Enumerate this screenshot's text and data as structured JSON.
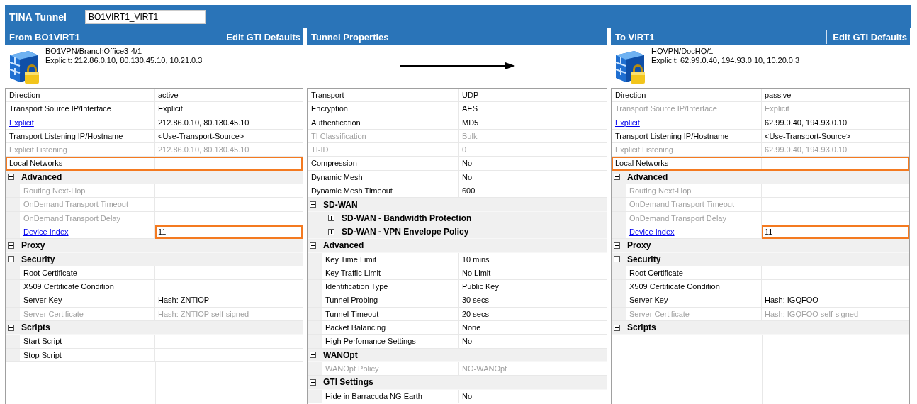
{
  "tunnel": {
    "label": "TINA Tunnel",
    "name": "BO1VIRT1_VIRT1"
  },
  "panels": [
    {
      "kind": "endpoint",
      "title": "From BO1VIRT1",
      "edit_button": "Edit GTI Defaults",
      "device": {
        "name": "BO1VPN/BranchOffice3-4/1",
        "address": "Explicit: 212.86.0.10, 80.130.45.10, 10.21.0.3"
      },
      "rows": [
        {
          "kind": "property",
          "label": "Direction",
          "value": "active",
          "disabled": false,
          "link": false
        },
        {
          "kind": "property",
          "label": "Transport Source IP/Interface",
          "value": "Explicit",
          "disabled": false,
          "link": false
        },
        {
          "kind": "property",
          "label": "Explicit",
          "value": "212.86.0.10, 80.130.45.10",
          "disabled": false,
          "link": true
        },
        {
          "kind": "property",
          "label": "Transport Listening IP/Hostname",
          "value": "<Use-Transport-Source>",
          "disabled": false,
          "link": false
        },
        {
          "kind": "property",
          "label": "Explicit Listening",
          "value": "212.86.0.10, 80.130.45.10",
          "disabled": true,
          "link": false
        },
        {
          "kind": "property",
          "label": "Local Networks",
          "disabled": false,
          "link": false,
          "highlighted": true
        },
        {
          "kind": "group",
          "label": "Advanced",
          "expanded": true,
          "children": [
            {
              "kind": "property",
              "label": "Routing Next-Hop",
              "disabled": true,
              "link": false
            },
            {
              "kind": "property",
              "label": "OnDemand Transport Timeout",
              "disabled": true,
              "link": false
            },
            {
              "kind": "property",
              "label": "OnDemand Transport Delay",
              "disabled": true,
              "link": false
            },
            {
              "kind": "property",
              "label": "Device Index",
              "value": "11",
              "disabled": false,
              "link": true,
              "value_highlighted": true
            }
          ]
        },
        {
          "kind": "group",
          "label": "Proxy",
          "expanded": false
        },
        {
          "kind": "group",
          "label": "Security",
          "expanded": true,
          "children": [
            {
              "kind": "property",
              "label": "Root Certificate",
              "disabled": false,
              "link": false
            },
            {
              "kind": "property",
              "label": "X509 Certificate Condition",
              "disabled": false,
              "link": false
            },
            {
              "kind": "property",
              "label": "Server Key",
              "value": "Hash: ZNTIOP",
              "disabled": false,
              "link": false
            },
            {
              "kind": "property",
              "label": "Server Certificate",
              "value": "Hash: ZNTIOP self-signed",
              "disabled": true,
              "link": false
            }
          ]
        },
        {
          "kind": "group",
          "label": "Scripts",
          "expanded": true,
          "children": [
            {
              "kind": "property",
              "label": "Start Script",
              "disabled": false,
              "link": false
            },
            {
              "kind": "property",
              "label": "Stop Script",
              "disabled": false,
              "link": false
            }
          ]
        }
      ]
    },
    {
      "kind": "tunnel",
      "title": "Tunnel Properties",
      "rows": [
        {
          "kind": "property",
          "label": "Transport",
          "value": "UDP",
          "disabled": false,
          "link": false
        },
        {
          "kind": "property",
          "label": "Encryption",
          "value": "AES",
          "disabled": false,
          "link": false
        },
        {
          "kind": "property",
          "label": "Authentication",
          "value": "MD5",
          "disabled": false,
          "link": false
        },
        {
          "kind": "property",
          "label": "TI Classification",
          "value": "Bulk",
          "disabled": true,
          "link": false
        },
        {
          "kind": "property",
          "label": "TI-ID",
          "value": "0",
          "disabled": true,
          "link": false
        },
        {
          "kind": "property",
          "label": "Compression",
          "value": "No",
          "disabled": false,
          "link": false
        },
        {
          "kind": "property",
          "label": "Dynamic Mesh",
          "value": "No",
          "disabled": false,
          "link": false
        },
        {
          "kind": "property",
          "label": "Dynamic Mesh Timeout",
          "value": "600",
          "disabled": false,
          "link": false
        },
        {
          "kind": "group",
          "label": "SD-WAN",
          "expanded": true,
          "children": [
            {
              "kind": "group",
              "label": "SD-WAN - Bandwidth Protection",
              "expanded": false
            },
            {
              "kind": "group",
              "label": "SD-WAN - VPN Envelope Policy",
              "expanded": false
            }
          ]
        },
        {
          "kind": "group",
          "label": "Advanced",
          "expanded": true,
          "children": [
            {
              "kind": "property",
              "label": "Key Time Limit",
              "value": "10 mins",
              "disabled": false,
              "link": false
            },
            {
              "kind": "property",
              "label": "Key Traffic Limit",
              "value": "No Limit",
              "disabled": false,
              "link": false
            },
            {
              "kind": "property",
              "label": "Identification Type",
              "value": "Public Key",
              "disabled": false,
              "link": false
            },
            {
              "kind": "property",
              "label": "Tunnel Probing",
              "value": "30 secs",
              "disabled": false,
              "link": false
            },
            {
              "kind": "property",
              "label": "Tunnel Timeout",
              "value": "20 secs",
              "disabled": false,
              "link": false
            },
            {
              "kind": "property",
              "label": "Packet Balancing",
              "value": "None",
              "disabled": false,
              "link": false
            },
            {
              "kind": "property",
              "label": "High Perfomance Settings",
              "value": "No",
              "disabled": false,
              "link": false
            }
          ]
        },
        {
          "kind": "group",
          "label": "WANOpt",
          "expanded": true,
          "children": [
            {
              "kind": "property",
              "label": "WANOpt Policy",
              "value": "NO-WANOpt",
              "disabled": true,
              "link": false
            }
          ]
        },
        {
          "kind": "group",
          "label": "GTI Settings",
          "expanded": true,
          "children": [
            {
              "kind": "property",
              "label": "Hide in Barracuda NG Earth",
              "value": "No",
              "disabled": false,
              "link": false
            }
          ]
        }
      ]
    },
    {
      "kind": "endpoint",
      "title": "To VIRT1",
      "edit_button": "Edit GTI Defaults",
      "device": {
        "name": "HQVPN/DocHQ/1",
        "address": "Explicit: 62.99.0.40, 194.93.0.10, 10.20.0.3"
      },
      "rows": [
        {
          "kind": "property",
          "label": "Direction",
          "value": "passive",
          "disabled": false,
          "link": false
        },
        {
          "kind": "property",
          "label": "Transport Source IP/Interface",
          "value": "Explicit",
          "disabled": true,
          "link": false
        },
        {
          "kind": "property",
          "label": "Explicit",
          "value": "62.99.0.40, 194.93.0.10",
          "disabled": false,
          "link": true
        },
        {
          "kind": "property",
          "label": "Transport Listening IP/Hostname",
          "value": "<Use-Transport-Source>",
          "disabled": false,
          "link": false
        },
        {
          "kind": "property",
          "label": "Explicit Listening",
          "value": "62.99.0.40, 194.93.0.10",
          "disabled": true,
          "link": false
        },
        {
          "kind": "property",
          "label": "Local Networks",
          "disabled": false,
          "link": false,
          "highlighted": true
        },
        {
          "kind": "group",
          "label": "Advanced",
          "expanded": true,
          "children": [
            {
              "kind": "property",
              "label": "Routing Next-Hop",
              "disabled": true,
              "link": false
            },
            {
              "kind": "property",
              "label": "OnDemand Transport Timeout",
              "disabled": true,
              "link": false
            },
            {
              "kind": "property",
              "label": "OnDemand Transport Delay",
              "disabled": true,
              "link": false
            },
            {
              "kind": "property",
              "label": "Device Index",
              "value": "11",
              "disabled": false,
              "link": true,
              "value_highlighted": true
            }
          ]
        },
        {
          "kind": "group",
          "label": "Proxy",
          "expanded": false
        },
        {
          "kind": "group",
          "label": "Security",
          "expanded": true,
          "children": [
            {
              "kind": "property",
              "label": "Root Certificate",
              "disabled": false,
              "link": false
            },
            {
              "kind": "property",
              "label": "X509 Certificate Condition",
              "disabled": false,
              "link": false
            },
            {
              "kind": "property",
              "label": "Server Key",
              "value": "Hash: IGQFOO",
              "disabled": false,
              "link": false
            },
            {
              "kind": "property",
              "label": "Server Certificate",
              "value": "Hash: IGQFOO self-signed",
              "disabled": true,
              "link": false
            }
          ]
        },
        {
          "kind": "group",
          "label": "Scripts",
          "expanded": false
        }
      ]
    }
  ]
}
